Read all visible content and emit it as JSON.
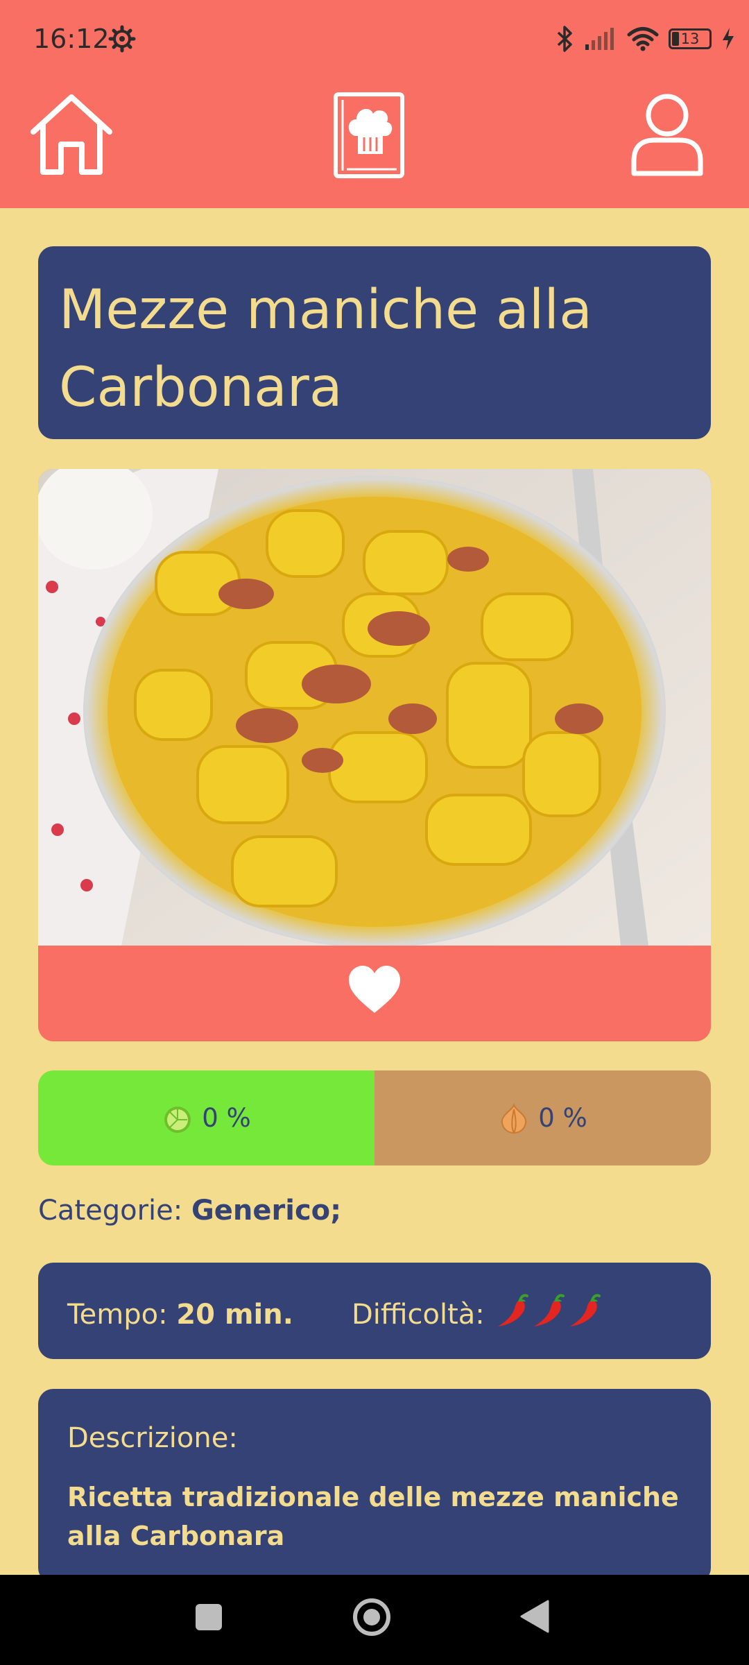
{
  "status_bar": {
    "time": "16:12",
    "battery_level": "13"
  },
  "nav": {
    "home_icon": "home-icon",
    "recipe_book_icon": "chef-book-icon",
    "profile_icon": "user-icon"
  },
  "recipe": {
    "title": "Mezze maniche alla Carbonara",
    "image_alt": "Piatto di mezze maniche alla carbonara",
    "favorite_icon": "heart-icon",
    "vegan_percent": "0 %",
    "vegetarian_percent": "0 %",
    "category_label": "Categorie:",
    "category_value": "Generico;",
    "time_label": "Tempo:",
    "time_value": "20 min.",
    "difficulty_label": "Difficoltà:",
    "difficulty_level": 3,
    "description_label": "Descrizione:",
    "description_text": "Ricetta tradizionale delle mezze maniche alla Carbonara"
  },
  "colors": {
    "header": "#F96F63",
    "background": "#F4DC8F",
    "navy": "#344276",
    "vegan_bar": "#76E83A",
    "vegetarian_bar": "#C9975F"
  }
}
